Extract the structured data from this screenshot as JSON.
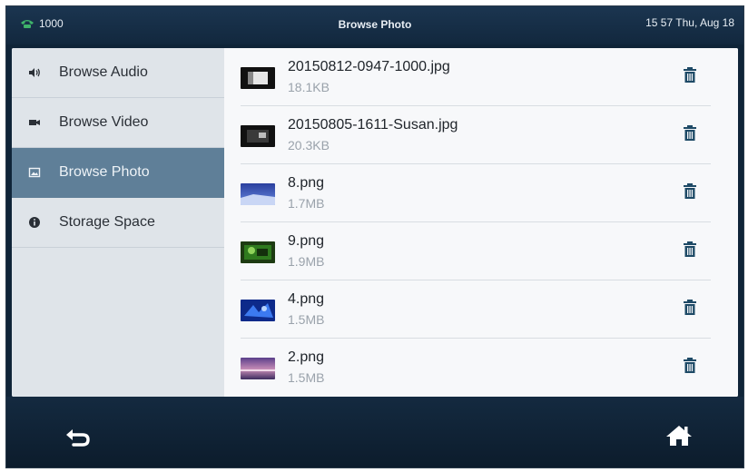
{
  "topbar": {
    "line_number": "1000",
    "title": "Browse Photo",
    "clock": "15 57 Thu, Aug 18"
  },
  "sidebar": {
    "items": [
      {
        "label": "Browse Audio",
        "icon": "speaker-icon"
      },
      {
        "label": "Browse Video",
        "icon": "video-camera-icon"
      },
      {
        "label": "Browse Photo",
        "icon": "photo-icon",
        "selected": true
      },
      {
        "label": "Storage Space",
        "icon": "info-icon"
      }
    ]
  },
  "files": [
    {
      "name": "20150812-0947-1000.jpg",
      "size": "18.1KB",
      "thumb": "dark-frame"
    },
    {
      "name": "20150805-1611-Susan.jpg",
      "size": "20.3KB",
      "thumb": "dark-frame"
    },
    {
      "name": "8.png",
      "size": "1.7MB",
      "thumb": "blue-sky"
    },
    {
      "name": "9.png",
      "size": "1.9MB",
      "thumb": "green-field"
    },
    {
      "name": "4.png",
      "size": "1.5MB",
      "thumb": "blue-abstract"
    },
    {
      "name": "2.png",
      "size": "1.5MB",
      "thumb": "purple-sunset"
    }
  ],
  "colors": {
    "accent_selected": "#5f7f98",
    "status_green": "#3fb36a"
  },
  "bottombar": {
    "back_icon": "back-arrow-icon",
    "home_icon": "home-icon"
  }
}
